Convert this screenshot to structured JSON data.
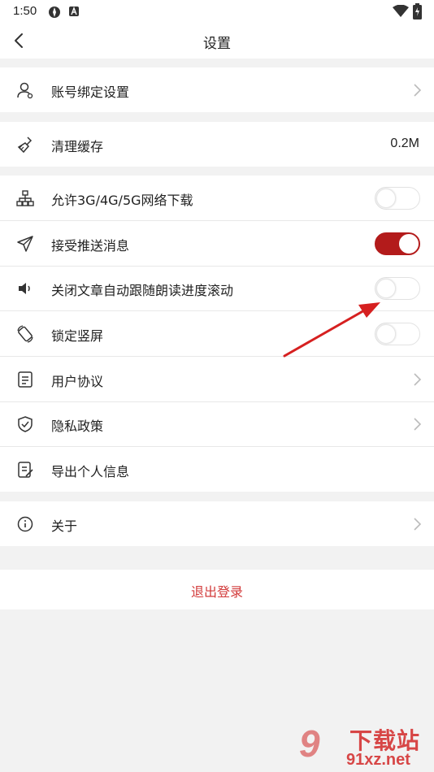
{
  "status_bar": {
    "time": "1:50"
  },
  "header": {
    "title": "设置"
  },
  "account": {
    "label": "账号绑定设置"
  },
  "cache": {
    "label": "清理缓存",
    "value": "0.2M"
  },
  "toggles": [
    {
      "label": "允许3G/4G/5G网络下载",
      "on": false
    },
    {
      "label": "接受推送消息",
      "on": true
    },
    {
      "label": "关闭文章自动跟随朗读进度滚动",
      "on": false
    },
    {
      "label": "锁定竖屏",
      "on": false
    }
  ],
  "links": [
    {
      "label": "用户协议"
    },
    {
      "label": "隐私政策"
    },
    {
      "label": "导出个人信息"
    }
  ],
  "about": {
    "label": "关于"
  },
  "logout": {
    "label": "退出登录"
  },
  "watermark": {
    "number": "9",
    "brand": "下载站",
    "domain": "91xz.net"
  },
  "colors": {
    "accent": "#b31b1b",
    "logout_text": "#d23a3a",
    "background": "#f2f2f2"
  }
}
